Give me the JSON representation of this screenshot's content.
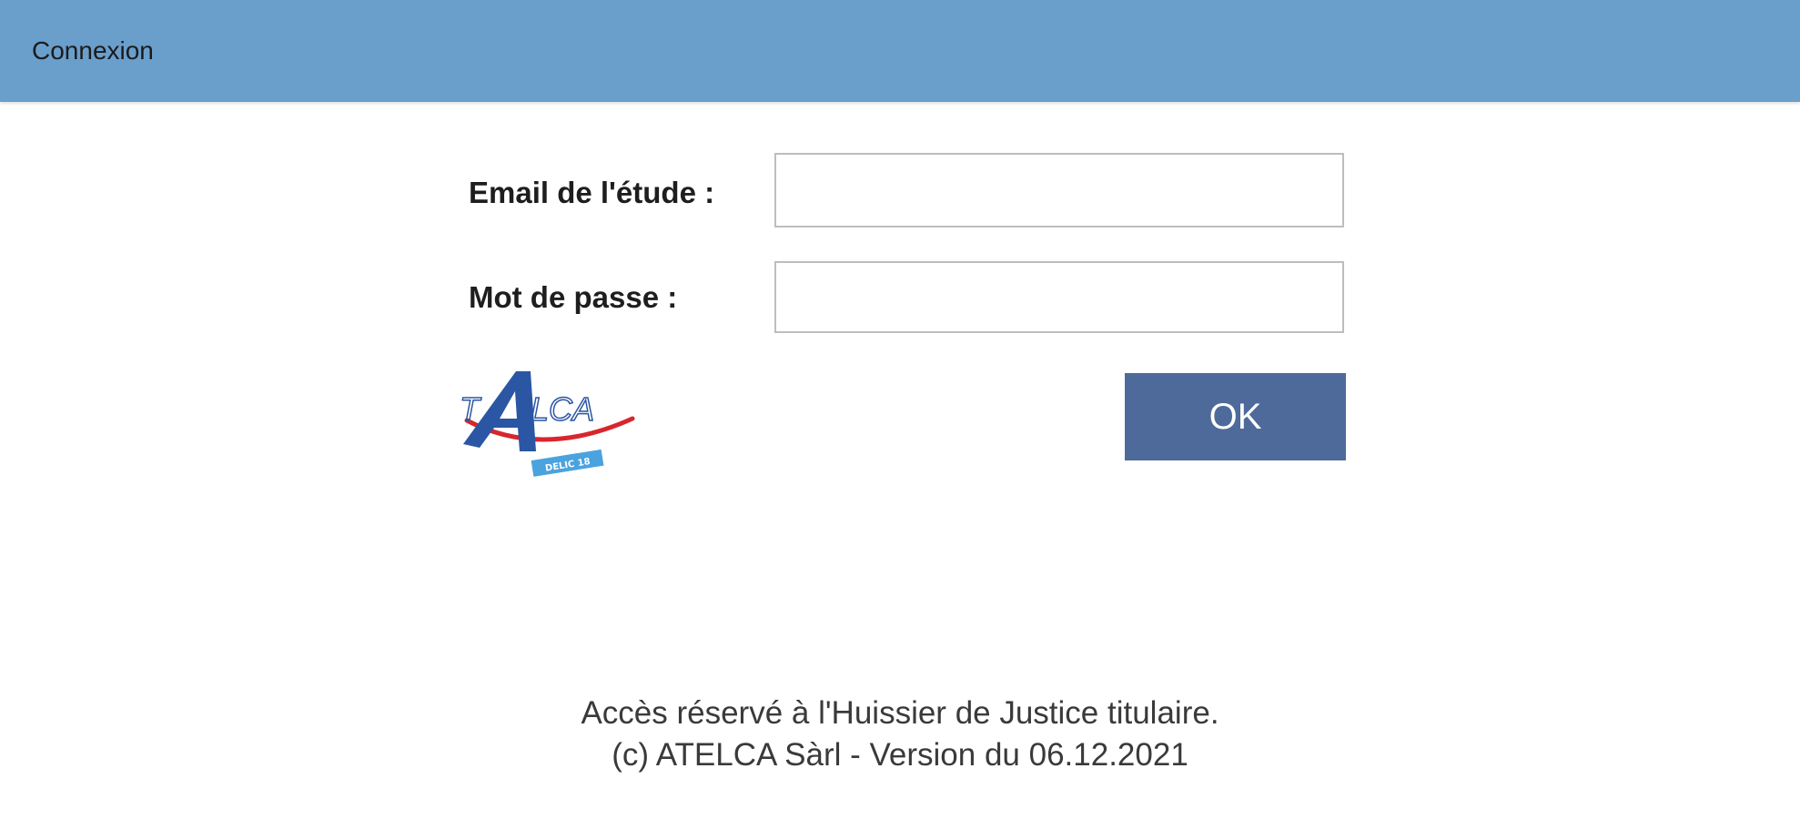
{
  "window": {
    "title": "Connexion"
  },
  "form": {
    "email_label": "Email de l'étude :",
    "email_value": "",
    "password_label": "Mot de passe :",
    "password_value": "",
    "ok_label": "OK"
  },
  "logo": {
    "text": "ATELCA",
    "sub_text": "DELIC 18",
    "icon": "atelca-logo"
  },
  "footer": {
    "line1": "Accès réservé à l'Huissier de Justice titulaire.",
    "line2": "(c) ATELCA Sàrl - Version du 06.12.2021"
  },
  "colors": {
    "titlebar": "#6a9ecb",
    "button": "#4e6a9b",
    "logo_blue": "#2b56a4",
    "logo_red": "#d8262c",
    "logo_badge": "#4aa3df"
  }
}
